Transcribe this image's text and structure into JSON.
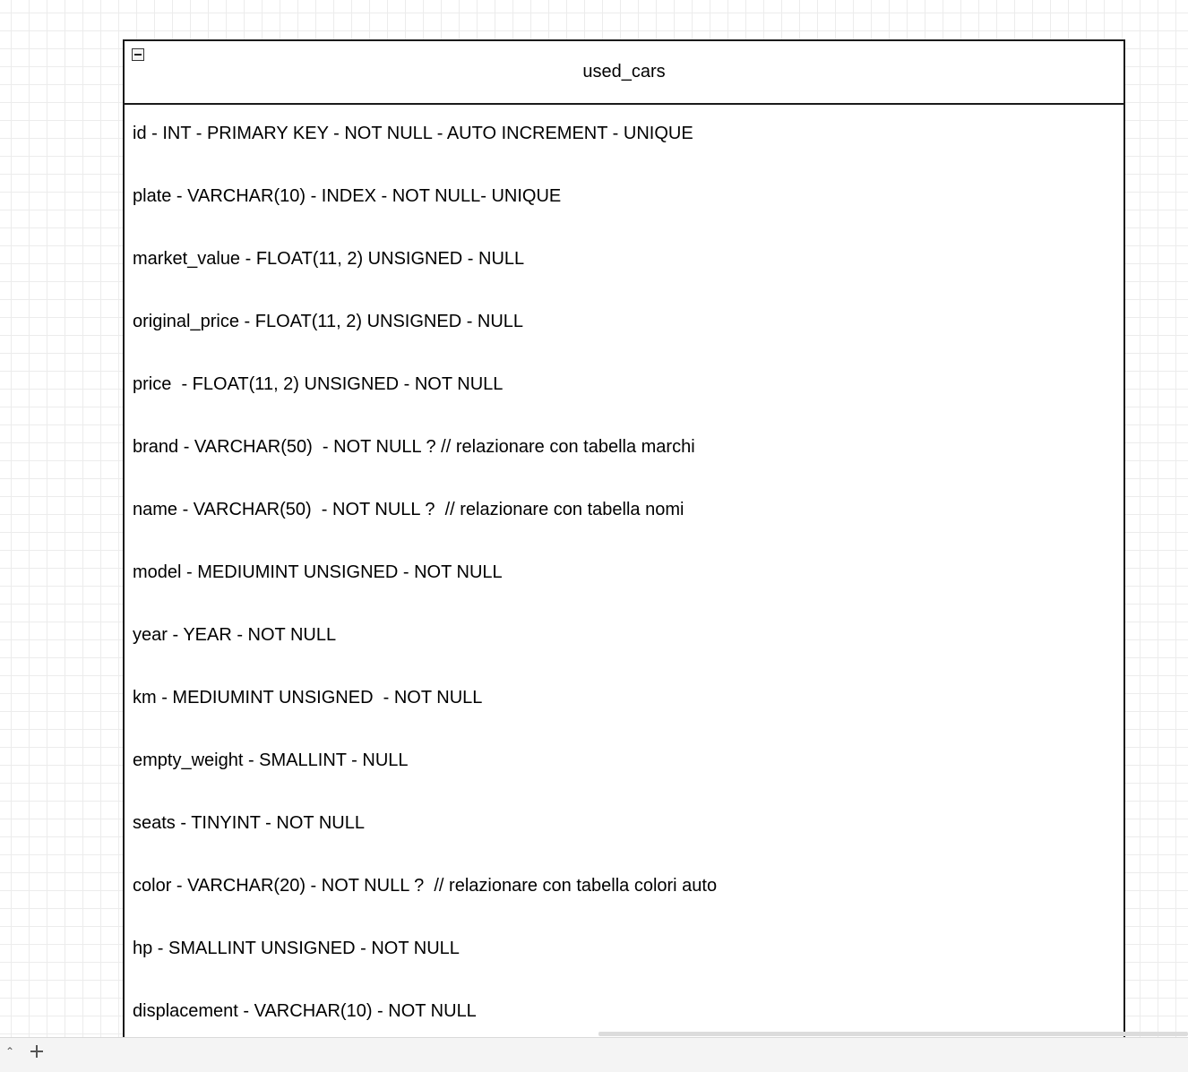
{
  "table": {
    "title": "used_cars",
    "fields": [
      "id - INT - PRIMARY KEY - NOT NULL - AUTO INCREMENT - UNIQUE",
      "plate - VARCHAR(10) - INDEX - NOT NULL- UNIQUE",
      "market_value - FLOAT(11, 2) UNSIGNED - NULL",
      "original_price - FLOAT(11, 2) UNSIGNED - NULL",
      "price  - FLOAT(11, 2) UNSIGNED - NOT NULL",
      "brand - VARCHAR(50)  - NOT NULL ? // relazionare con tabella marchi",
      "name - VARCHAR(50)  - NOT NULL ?  // relazionare con tabella nomi",
      "model - MEDIUMINT UNSIGNED - NOT NULL",
      "year - YEAR - NOT NULL",
      "km - MEDIUMINT UNSIGNED  - NOT NULL",
      "empty_weight - SMALLINT - NULL",
      "seats - TINYINT - NOT NULL",
      "color - VARCHAR(20) - NOT NULL ?  // relazionare con tabella colori auto",
      "hp - SMALLINT UNSIGNED - NOT NULL",
      "displacement - VARCHAR(10) - NOT NULL"
    ]
  },
  "icons": {
    "collapse": "minus-square-icon",
    "page_menu": "chevron-up-icon",
    "add_page": "plus-icon"
  },
  "colors": {
    "border": "#1a1a1a",
    "grid": "#ececec",
    "toolbar": "#f4f4f4"
  }
}
